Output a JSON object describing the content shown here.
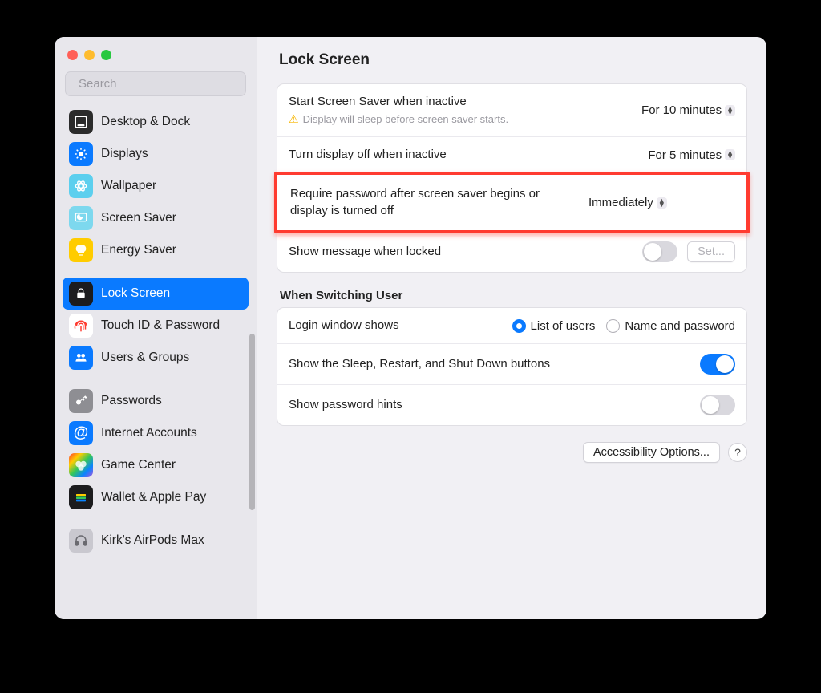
{
  "search": {
    "placeholder": "Search"
  },
  "page": {
    "title": "Lock Screen"
  },
  "sidebar": {
    "groups": [
      {
        "items": [
          {
            "label": "Desktop & Dock"
          },
          {
            "label": "Displays"
          },
          {
            "label": "Wallpaper"
          },
          {
            "label": "Screen Saver"
          },
          {
            "label": "Energy Saver"
          }
        ]
      },
      {
        "items": [
          {
            "label": "Lock Screen"
          },
          {
            "label": "Touch ID & Password"
          },
          {
            "label": "Users & Groups"
          }
        ]
      },
      {
        "items": [
          {
            "label": "Passwords"
          },
          {
            "label": "Internet Accounts"
          },
          {
            "label": "Game Center"
          },
          {
            "label": "Wallet & Apple Pay"
          }
        ]
      },
      {
        "items": [
          {
            "label": "Kirk's AirPods Max"
          }
        ]
      }
    ]
  },
  "settings": {
    "screensaver_label": "Start Screen Saver when inactive",
    "screensaver_value": "For 10 minutes",
    "screensaver_warning": "Display will sleep before screen saver starts.",
    "display_off_label": "Turn display off when inactive",
    "display_off_value": "For 5 minutes",
    "require_password_label": "Require password after screen saver begins or display is turned off",
    "require_password_value": "Immediately",
    "show_message_label": "Show message when locked",
    "set_button": "Set...",
    "switching_header": "When Switching User",
    "login_shows_label": "Login window shows",
    "login_option_list": "List of users",
    "login_option_name": "Name and password",
    "show_buttons_label": "Show the Sleep, Restart, and Shut Down buttons",
    "show_hints_label": "Show password hints"
  },
  "footer": {
    "accessibility": "Accessibility Options...",
    "help": "?"
  }
}
